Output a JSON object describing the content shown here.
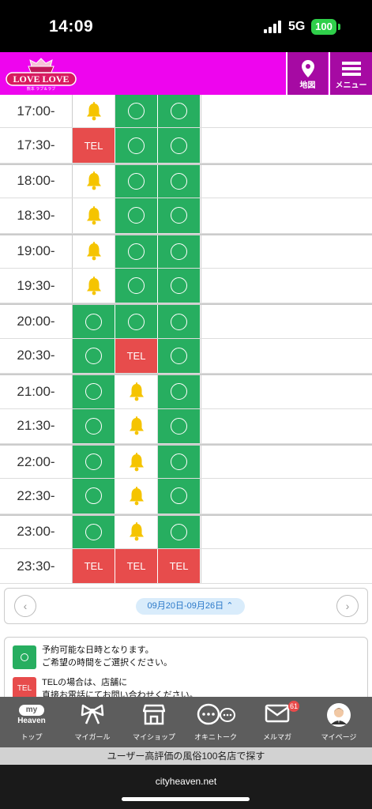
{
  "status_bar": {
    "time": "14:09",
    "network": "5G",
    "battery": "100"
  },
  "header": {
    "logo_text": "LOVE LOVE",
    "logo_subtext": "熊本 ラブ＆ラブ",
    "map_label": "地図",
    "menu_label": "メニュー"
  },
  "schedule": {
    "rows": [
      {
        "time": "17:00-",
        "cells": [
          "bell",
          "ok",
          "ok"
        ]
      },
      {
        "time": "17:30-",
        "cells": [
          "tel",
          "ok",
          "ok"
        ]
      },
      {
        "time": "18:00-",
        "cells": [
          "bell",
          "ok",
          "ok"
        ]
      },
      {
        "time": "18:30-",
        "cells": [
          "bell",
          "ok",
          "ok"
        ]
      },
      {
        "time": "19:00-",
        "cells": [
          "bell",
          "ok",
          "ok"
        ]
      },
      {
        "time": "19:30-",
        "cells": [
          "bell",
          "ok",
          "ok"
        ]
      },
      {
        "time": "20:00-",
        "cells": [
          "ok",
          "ok",
          "ok"
        ]
      },
      {
        "time": "20:30-",
        "cells": [
          "ok",
          "tel",
          "ok"
        ]
      },
      {
        "time": "21:00-",
        "cells": [
          "ok",
          "bell",
          "ok"
        ]
      },
      {
        "time": "21:30-",
        "cells": [
          "ok",
          "bell",
          "ok"
        ]
      },
      {
        "time": "22:00-",
        "cells": [
          "ok",
          "bell",
          "ok"
        ]
      },
      {
        "time": "22:30-",
        "cells": [
          "ok",
          "bell",
          "ok"
        ]
      },
      {
        "time": "23:00-",
        "cells": [
          "ok",
          "bell",
          "ok"
        ]
      },
      {
        "time": "23:30-",
        "cells": [
          "tel",
          "tel",
          "tel"
        ]
      }
    ],
    "tel_label": "TEL"
  },
  "pager": {
    "prev": "‹",
    "next": "›",
    "range": "09月20日-09月26日"
  },
  "legend": {
    "available_line1": "予約可能な日時となります。",
    "available_line2": "ご希望の時間をご選択ください。",
    "tel_icon": "TEL",
    "tel_line1": "TELの場合は、店舗に",
    "tel_line2": "直接お電話にてお問い合わせください。"
  },
  "bottom_nav": {
    "items": [
      {
        "label": "トップ",
        "icon": "my-heaven-icon"
      },
      {
        "label": "マイガール",
        "icon": "ribbon-icon"
      },
      {
        "label": "マイショップ",
        "icon": "shop-icon"
      },
      {
        "label": "オキニトーク",
        "icon": "chat-icon"
      },
      {
        "label": "メルマガ",
        "icon": "mail-icon",
        "badge": "61"
      },
      {
        "label": "マイページ",
        "icon": "avatar-icon"
      }
    ],
    "top_logo_line1": "my",
    "top_logo_line2": "Heaven"
  },
  "banner": "ユーザー高評価の風俗100名店で探す",
  "browser": {
    "url": "cityheaven.net"
  },
  "colors": {
    "header": "#ee05ee",
    "available": "#27ae60",
    "tel": "#e74c4c",
    "bell": "#f5c400"
  }
}
